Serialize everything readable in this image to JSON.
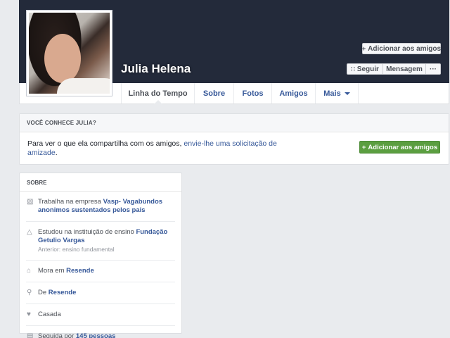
{
  "profile": {
    "name": "Julia Helena"
  },
  "header_buttons": {
    "add_friend": "Adicionar aos amigos",
    "follow": "Seguir",
    "message": "Mensagem",
    "more": "···"
  },
  "tabs": [
    {
      "label": "Linha do Tempo"
    },
    {
      "label": "Sobre"
    },
    {
      "label": "Fotos"
    },
    {
      "label": "Amigos"
    },
    {
      "label": "Mais"
    }
  ],
  "know_box": {
    "title": "VOCÊ CONHECE JULIA?",
    "text": "Para ver o que ela compartilha com os amigos, ",
    "link": "envie-lhe uma solicitação de amizade",
    "end": ".",
    "button": "Adicionar aos amigos"
  },
  "about": {
    "title": "SOBRE",
    "work": {
      "prefix": "Trabalha na empresa ",
      "link": "Vasp- Vagabundos anonimos sustentados pelos pais"
    },
    "study": {
      "prefix": "Estudou na instituição de ensino ",
      "link": "Fundação Getulio Vargas",
      "sub": "Anterior: ensino fundamental"
    },
    "lives": {
      "prefix": "Mora em ",
      "link": "Resende"
    },
    "from": {
      "prefix": "De ",
      "link": "Resende"
    },
    "relationship": {
      "text": "Casada"
    },
    "followed": {
      "prefix": "Seguida por ",
      "link": "145 pessoas"
    }
  }
}
